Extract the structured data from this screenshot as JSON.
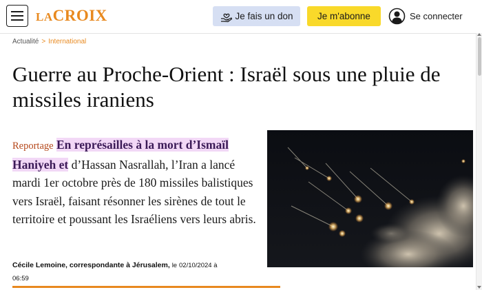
{
  "header": {
    "logo_prefix": "LA",
    "logo_name": "CROIX",
    "donate_label": "Je fais un don",
    "subscribe_label": "Je m'abonne",
    "login_label": "Se connecter"
  },
  "breadcrumb": {
    "items": [
      "Actualité",
      "International"
    ],
    "separator": ">"
  },
  "article": {
    "title": "Guerre au Proche-Orient : Israël sous une pluie de missiles iraniens",
    "kicker": "Reportage",
    "lead_link": "En représailles à la mort d’Ismaïl Haniyeh et",
    "lead_rest": " d’Hassan Nasrallah, l’Iran a lancé mardi 1er octobre près de 180 missiles balistiques vers Israël, faisant résonner les sirènes de tout le territoire et poussant les Israéliens vers leurs abris.",
    "author": "Cécile Lemoine, correspondante à Jérusalem,",
    "date_prefix": "le",
    "date": "02/10/2024 à",
    "time": "06:59"
  },
  "icons": {
    "menu": "menu-icon",
    "donate": "hand-heart-icon",
    "user": "user-circle-icon"
  },
  "colors": {
    "brand": "#e8891f",
    "donate_bg": "#d6dff3",
    "subscribe_bg": "#f9d92a",
    "kicker": "#b5481b",
    "highlight_bg": "#f2d8f6"
  }
}
